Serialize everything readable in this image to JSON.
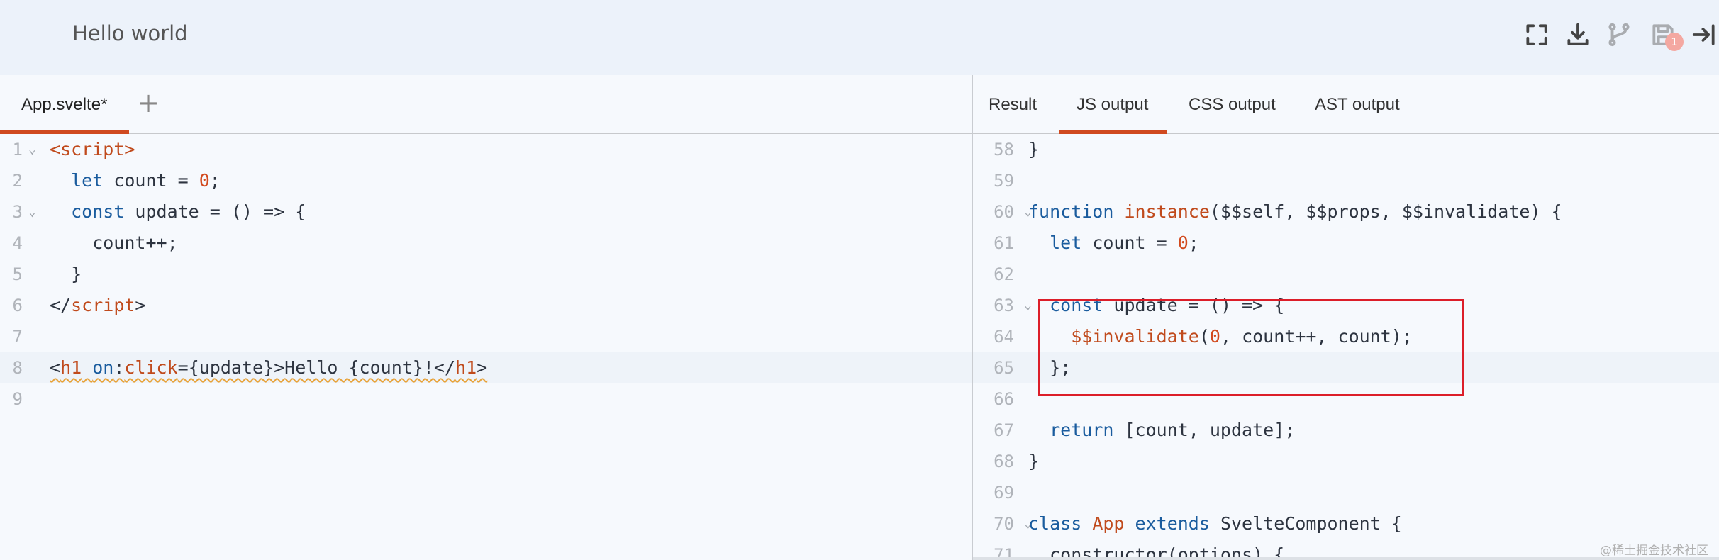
{
  "header": {
    "title": "Hello world",
    "icons": [
      "fullscreen-icon",
      "download-icon",
      "fork-icon",
      "save-icon",
      "logout-icon"
    ],
    "save_badge": "1"
  },
  "editor": {
    "file_tab": "App.svelte*",
    "add_label": "+",
    "lines": [
      {
        "n": "1",
        "tokens": [
          [
            "tag",
            "<"
          ],
          [
            "tag",
            "script"
          ],
          [
            "tag",
            ">"
          ]
        ]
      },
      {
        "n": "2",
        "tokens": [
          [
            "plain",
            "  "
          ],
          [
            "kw",
            "let"
          ],
          [
            "plain",
            " count = "
          ],
          [
            "num",
            "0"
          ],
          [
            "plain",
            ";"
          ]
        ]
      },
      {
        "n": "3",
        "tokens": [
          [
            "plain",
            "  "
          ],
          [
            "kw",
            "const"
          ],
          [
            "plain",
            " update = () => {"
          ]
        ]
      },
      {
        "n": "4",
        "tokens": [
          [
            "plain",
            "    count++;"
          ]
        ]
      },
      {
        "n": "5",
        "tokens": [
          [
            "plain",
            "  }"
          ]
        ]
      },
      {
        "n": "6",
        "tokens": [
          [
            "plain",
            "</"
          ],
          [
            "tag",
            "script"
          ],
          [
            "plain",
            ">"
          ]
        ]
      },
      {
        "n": "7",
        "tokens": []
      },
      {
        "n": "8",
        "tokens": [
          [
            "plain",
            "<"
          ],
          [
            "tag",
            "h1"
          ],
          [
            "plain",
            " "
          ],
          [
            "kw",
            "on"
          ],
          [
            "plain",
            ":"
          ],
          [
            "tag",
            "click"
          ],
          [
            "plain",
            "={update}>Hello {count}!</"
          ],
          [
            "tag",
            "h1"
          ],
          [
            "plain",
            ">"
          ]
        ]
      },
      {
        "n": "9",
        "tokens": []
      }
    ]
  },
  "output": {
    "tabs": [
      "Result",
      "JS output",
      "CSS output",
      "AST output"
    ],
    "active_tab": "JS output",
    "lines": [
      {
        "n": "58",
        "tokens": [
          [
            "plain",
            "}"
          ]
        ]
      },
      {
        "n": "59",
        "tokens": []
      },
      {
        "n": "60",
        "tokens": [
          [
            "kw",
            "function"
          ],
          [
            "plain",
            " "
          ],
          [
            "fn",
            "instance"
          ],
          [
            "plain",
            "($$self, $$props, $$invalidate) {"
          ]
        ]
      },
      {
        "n": "61",
        "tokens": [
          [
            "plain",
            "  "
          ],
          [
            "kw",
            "let"
          ],
          [
            "plain",
            " count = "
          ],
          [
            "num",
            "0"
          ],
          [
            "plain",
            ";"
          ]
        ]
      },
      {
        "n": "62",
        "tokens": []
      },
      {
        "n": "63",
        "tokens": [
          [
            "plain",
            "  "
          ],
          [
            "kw",
            "const"
          ],
          [
            "plain",
            " update = () => {"
          ]
        ]
      },
      {
        "n": "64",
        "tokens": [
          [
            "plain",
            "    "
          ],
          [
            "fn",
            "$$invalidate"
          ],
          [
            "plain",
            "("
          ],
          [
            "num",
            "0"
          ],
          [
            "plain",
            ", count++, count);"
          ]
        ]
      },
      {
        "n": "65",
        "tokens": [
          [
            "plain",
            "  };"
          ]
        ]
      },
      {
        "n": "66",
        "tokens": []
      },
      {
        "n": "67",
        "tokens": [
          [
            "plain",
            "  "
          ],
          [
            "kw",
            "return"
          ],
          [
            "plain",
            " [count, update];"
          ]
        ]
      },
      {
        "n": "68",
        "tokens": [
          [
            "plain",
            "}"
          ]
        ]
      },
      {
        "n": "69",
        "tokens": []
      },
      {
        "n": "70",
        "tokens": [
          [
            "kw",
            "class"
          ],
          [
            "plain",
            " "
          ],
          [
            "fn",
            "App"
          ],
          [
            "plain",
            " "
          ],
          [
            "kw",
            "extends"
          ],
          [
            "plain",
            " SvelteComponent {"
          ]
        ]
      },
      {
        "n": "71",
        "tokens": [
          [
            "plain",
            "  constructor(options) {"
          ]
        ]
      }
    ]
  },
  "watermark": "@稀土掘金技术社区",
  "colors": {
    "accent": "#d04a20",
    "highlight_box": "#dc1e29",
    "header_bg": "#ecf2fa",
    "pane_bg": "#f6f9fd",
    "keyword": "#1a5c9e",
    "tag": "#c04a1c",
    "number": "#d24a1e"
  }
}
